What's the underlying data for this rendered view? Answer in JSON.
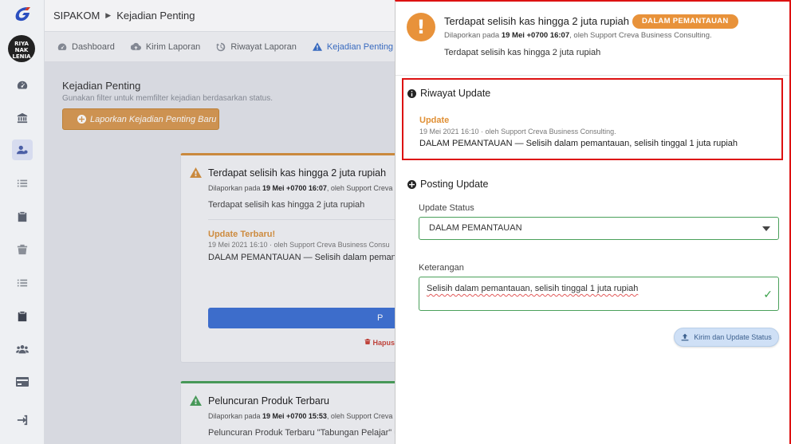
{
  "header": {
    "app_name": "SIPAKOM",
    "breadcrumb_sep": "▶",
    "page": "Kejadian Penting"
  },
  "rail": {
    "avatar_text": "RIYA NAK LENIA",
    "icons": [
      "dashboard-icon",
      "bank-icon",
      "user-icon",
      "list-icon",
      "clipboard-check-icon",
      "trash-icon",
      "list-icon",
      "clipboard-check-icon",
      "users-icon",
      "card-icon",
      "logout-icon"
    ]
  },
  "tabs": [
    {
      "label": "Dashboard",
      "icon": "dashboard-icon"
    },
    {
      "label": "Kirim Laporan",
      "icon": "cloud-upload-icon"
    },
    {
      "label": "Riwayat Laporan",
      "icon": "history-icon"
    },
    {
      "label": "Kejadian Penting",
      "icon": "warning-icon"
    }
  ],
  "main": {
    "title": "Kejadian Penting",
    "subtitle": "Gunakan filter untuk memfilter kejadian berdasarkan status.",
    "new_button": "Laporkan Kejadian Penting Baru"
  },
  "cards": [
    {
      "title": "Terdapat selisih kas hingga 2 juta rupiah",
      "meta_prefix": "Dilaporkan pada ",
      "meta_date": "19 Mei +0700 16:07",
      "meta_suffix": ", oleh Support Creva",
      "desc": "Terdapat selisih kas hingga 2 juta rupiah",
      "update_title": "Update Terbaru!",
      "update_meta": "19 Mei 2021 16:10 · oleh Support Creva Business Consu",
      "update_desc": "DALAM PEMANTAUAN — Selisih dalam pemant",
      "button_label": "P",
      "delete_label": "Hapus"
    },
    {
      "title": "Peluncuran Produk Terbaru",
      "meta_prefix": "Dilaporkan pada ",
      "meta_date": "19 Mei +0700 15:53",
      "meta_suffix": ", oleh Support Creva",
      "desc": "Peluncuran Produk Terbaru \"Tabungan Pelajar\" u"
    }
  ],
  "panel": {
    "title": "Terdapat selisih kas hingga 2 juta rupiah",
    "status_badge": "DALAM PEMANTAUAN",
    "meta_prefix": "Dilaporkan pada ",
    "meta_date": "19 Mei +0700 16:07",
    "meta_suffix": ", oleh Support Creva Business Consulting.",
    "desc": "Terdapat selisih kas hingga 2 juta rupiah",
    "history_title": "Riwayat Update",
    "history": {
      "title": "Update",
      "meta": "19 Mei 2021 16:10 · oleh Support Creva Business Consulting.",
      "status": "DALAM PEMANTAUAN",
      "note": " — Selisih dalam pemantauan, selisih tinggal 1 juta rupiah"
    },
    "posting_title": "Posting Update",
    "status_label": "Update Status",
    "status_value": "DALAM PEMANTAUAN",
    "note_label": "Keterangan",
    "note_value": "Selisih dalam pemantauan, selisih tinggal 1 juta rupiah",
    "submit_label": "Kirim dan Update Status"
  },
  "colors": {
    "accent_orange": "#e8923a",
    "primary_blue": "#3f72d4",
    "success_green": "#4aa05a",
    "highlight_red": "#dd1111"
  }
}
